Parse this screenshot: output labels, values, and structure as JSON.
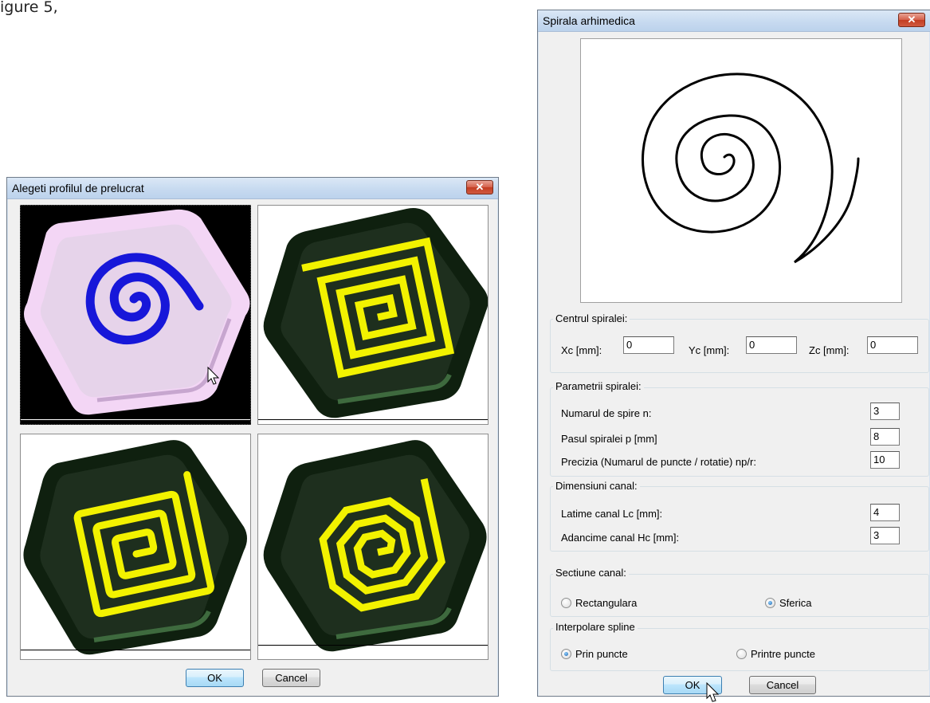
{
  "caption_fragment": "igure 5,",
  "profile_dialog": {
    "title": "Alegeti profilul de prelucrat",
    "close_glyph": "✕",
    "tiles": [
      {
        "name": "archimedean-spiral",
        "selected": true,
        "spiral_color": "#1717d9",
        "plate_color": "#f3d6f5"
      },
      {
        "name": "square-spiral",
        "selected": false,
        "spiral_color": "#f2f200",
        "plate_color": "#142a14"
      },
      {
        "name": "rounded-square-spiral",
        "selected": false,
        "spiral_color": "#f2f200",
        "plate_color": "#142a14"
      },
      {
        "name": "octagonal-spiral",
        "selected": false,
        "spiral_color": "#f2f200",
        "plate_color": "#142a14"
      }
    ],
    "ok_label": "OK",
    "cancel_label": "Cancel"
  },
  "spiral_dialog": {
    "title": "Spirala arhimedica",
    "close_glyph": "✕",
    "center_group": {
      "label": "Centrul spiralei:",
      "xc_label": "Xc [mm]:",
      "xc_value": "0",
      "yc_label": "Yc [mm]:",
      "yc_value": "0",
      "zc_label": "Zc [mm]:",
      "zc_value": "0"
    },
    "params_group": {
      "label": "Parametrii spiralei:",
      "turns_label": "Numarul de spire n:",
      "turns_value": "3",
      "pitch_label": "Pasul spiralei p [mm]",
      "pitch_value": "8",
      "precision_label": "Precizia (Numarul de puncte / rotatie)  np/r:",
      "precision_value": "10"
    },
    "channel_group": {
      "label": "Dimensiuni canal:",
      "width_label": "Latime canal Lc [mm]:",
      "width_value": "4",
      "depth_label": "Adancime canal Hc [mm]:",
      "depth_value": "3"
    },
    "section_group": {
      "label": "Sectiune canal:",
      "option_1": "Rectangulara",
      "option_2": "Sferica",
      "selected": "Sferica"
    },
    "spline_group": {
      "label": "Interpolare spline",
      "option_1": "Prin puncte",
      "option_2": "Printre puncte",
      "selected": "Prin puncte"
    },
    "ok_label": "OK",
    "cancel_label": "Cancel"
  },
  "colors": {
    "title_bar": "#c7daf0",
    "close_red": "#d05a3f",
    "window_bg": "#f0f0f0"
  }
}
